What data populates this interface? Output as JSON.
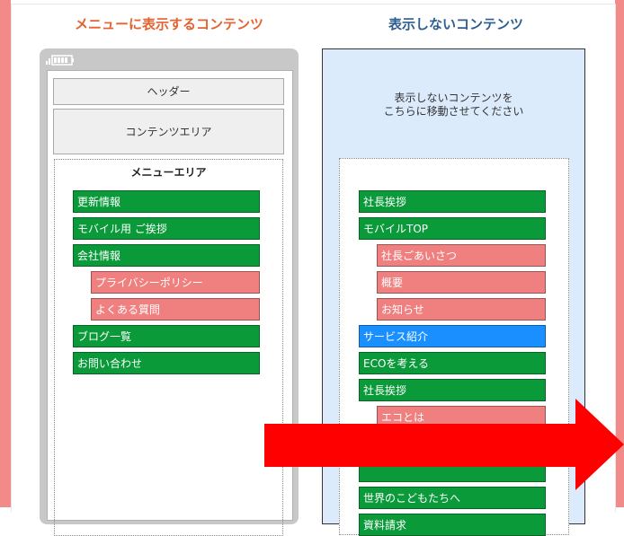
{
  "colors": {
    "frame": "#f28a8a",
    "menu_heading": "#e4622e",
    "hidden_heading": "#2d5e8e",
    "green_item": "#0a9a3a",
    "pink_item": "#f08080",
    "blue_item": "#1a8fff",
    "arrow": "#ff0000"
  },
  "left": {
    "heading": "メニューに表示するコンテンツ",
    "header_box": "ヘッダー",
    "content_box": "コンテンツエリア",
    "menu_title": "メニューエリア",
    "items": [
      {
        "label": "更新情報",
        "color": "green",
        "level": 0
      },
      {
        "label": "モバイル用 ご挨拶",
        "color": "green",
        "level": 0
      },
      {
        "label": "会社情報",
        "color": "green",
        "level": 0
      },
      {
        "label": "プライバシーポリシー",
        "color": "pink",
        "level": 1
      },
      {
        "label": "よくある質問",
        "color": "pink",
        "level": 1
      },
      {
        "label": "ブログ一覧",
        "color": "green",
        "level": 0
      },
      {
        "label": "お問い合わせ",
        "color": "green",
        "level": 0
      }
    ]
  },
  "right": {
    "heading": "表示しないコンテンツ",
    "message_line1": "表示しないコンテンツを",
    "message_line2": "こちらに移動させてください",
    "items": [
      {
        "label": "社長挨拶",
        "color": "green",
        "level": 0
      },
      {
        "label": "モバイルTOP",
        "color": "green",
        "level": 0
      },
      {
        "label": "社長ごあいさつ",
        "color": "pink",
        "level": 1
      },
      {
        "label": "概要",
        "color": "pink",
        "level": 1
      },
      {
        "label": "お知らせ",
        "color": "pink",
        "level": 1
      },
      {
        "label": "サービス紹介",
        "color": "blue",
        "level": 0
      },
      {
        "label": "ECOを考える",
        "color": "green",
        "level": 0
      },
      {
        "label": "社長挨拶",
        "color": "green",
        "level": 0
      },
      {
        "label": "エコとは",
        "color": "pink",
        "level": 1
      },
      {
        "label": "",
        "color": "pink",
        "level": 1
      },
      {
        "label": "",
        "color": "green",
        "level": 0
      },
      {
        "label": "世界のこどもたちへ",
        "color": "green",
        "level": 0
      },
      {
        "label": "資料請求",
        "color": "green",
        "level": 0
      }
    ]
  }
}
